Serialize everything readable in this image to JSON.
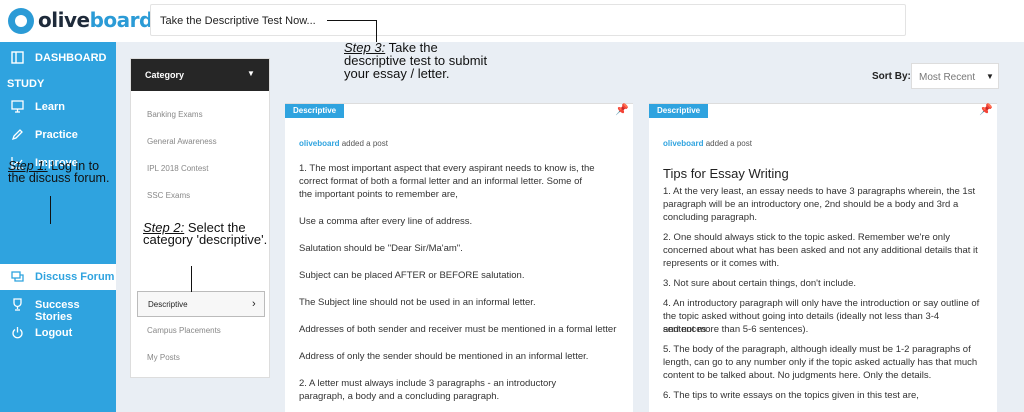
{
  "header": {
    "logo_olive": "olive",
    "logo_board": "board",
    "search_text": "Take the Descriptive Test Now..."
  },
  "sidebar": {
    "dashboard": "DASHBOARD",
    "study": "STUDY",
    "items": [
      {
        "label": "Learn",
        "icon": "monitor-icon"
      },
      {
        "label": "Practice",
        "icon": "pencil-icon"
      },
      {
        "label": "Improve",
        "icon": "chart-icon"
      },
      {
        "label": "Discuss Forum",
        "icon": "chat-icon"
      },
      {
        "label": "Success Stories",
        "icon": "trophy-icon"
      },
      {
        "label": "Logout",
        "icon": "power-icon"
      }
    ],
    "active": "Discuss Forum"
  },
  "annotations": {
    "step1_prefix": "Step 1:",
    "step1_text": "Log in to the discuss forum.",
    "step2_prefix": "Step 2:",
    "step2_text": "Select the category 'descriptive'.",
    "step3_prefix": "Step 3:",
    "step3_text": "Take the descriptive test to submit your essay / letter."
  },
  "category": {
    "header": "Category",
    "items": [
      "Banking Exams",
      "General Awareness",
      "IPL 2018 Contest",
      "SSC Exams"
    ],
    "selected": "Descriptive",
    "after": [
      "Campus Placements",
      "My Posts"
    ]
  },
  "sort": {
    "label": "Sort By:",
    "value": "Most Recent"
  },
  "posts": [
    {
      "tag": "Descriptive",
      "user": "oliveboard",
      "action": "added a post",
      "lines": [
        "1. The most important aspect that every aspirant needs to know is, the",
        "correct format of both a formal letter and an informal letter. Some of",
        "the important points to remember are,",
        "Use a comma after every line of address.",
        "Salutation should be \"Dear Sir/Ma'am\".",
        "Subject can be placed AFTER or BEFORE salutation.",
        "The Subject line should not be used in an informal letter.",
        "Addresses of both sender and receiver must be mentioned in a formal letter",
        "Address of only the sender should be mentioned in an informal letter.",
        "2. A letter must always include 3 paragraphs - an introductory",
        "paragraph, a body and a concluding paragraph."
      ]
    },
    {
      "tag": "Descriptive",
      "user": "oliveboard",
      "action": "added a post",
      "title": "Tips for Essay Writing",
      "lines": [
        "1. At the very least, an essay needs to have 3 paragraphs wherein, the 1st",
        "paragraph will be an introductory one, 2nd should be a body and 3rd a",
        "concluding paragraph.",
        "2. One should always stick to the topic asked. Remember we're only",
        "concerned about what has been asked and not any additional details that it",
        "represents or it comes with.",
        "3. Not sure about certain things, don't include.",
        "4. An introductory paragraph will only have the introduction or say outline of",
        "the topic asked without going into details (ideally not less than 3-4 sentences",
        "and not more than 5-6 sentences).",
        "5. The body of the paragraph, although ideally must be 1-2 paragraphs of",
        "length, can go to any number only if the topic asked actually has that much",
        "content to be talked about. No judgments here. Only the details.",
        "6. The tips to write essays on the topics given in this test are,"
      ]
    }
  ]
}
